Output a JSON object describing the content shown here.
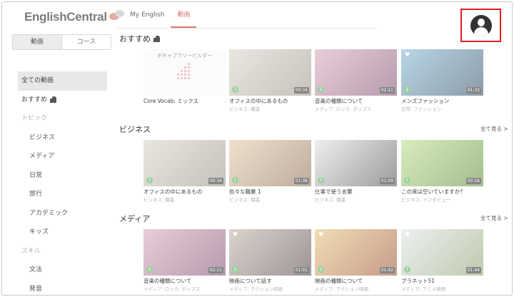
{
  "app": {
    "logo": "EnglishCentral"
  },
  "topnav": {
    "tabs": [
      {
        "label": "My English"
      },
      {
        "label": "動画"
      }
    ]
  },
  "sidebar": {
    "segment": [
      "動画",
      "コース"
    ],
    "items": [
      {
        "label": "全ての動画",
        "kind": "item",
        "active": true
      },
      {
        "label": "おすすめ",
        "kind": "item"
      },
      {
        "label": "トピック",
        "kind": "heading"
      },
      {
        "label": "ビジネス",
        "kind": "sub"
      },
      {
        "label": "メディア",
        "kind": "sub"
      },
      {
        "label": "日常",
        "kind": "sub"
      },
      {
        "label": "旅行",
        "kind": "sub"
      },
      {
        "label": "アカデミック",
        "kind": "sub"
      },
      {
        "label": "キッズ",
        "kind": "sub"
      },
      {
        "label": "スキル",
        "kind": "heading"
      },
      {
        "label": "文法",
        "kind": "sub"
      },
      {
        "label": "発音",
        "kind": "sub"
      }
    ]
  },
  "sections": [
    {
      "title": "おすすめ",
      "see_all": "",
      "cards": [
        {
          "title": "Core Vocab: ミックス",
          "category": "",
          "duration": "",
          "vocab_label": "ボキャブラリービルダー",
          "colors": [
            "#f5f5f5",
            "#eeeeee"
          ],
          "heart": false,
          "level": ""
        },
        {
          "title": "オフィスの中にあるもの",
          "category": "ビジネス: 職業",
          "duration": "00:34",
          "colors": [
            "#d9d2c8",
            "#9a8f84"
          ],
          "heart": false,
          "level": "1"
        },
        {
          "title": "音楽の種類について",
          "category": "メディア: ロック, ポップス",
          "duration": "02:11",
          "colors": [
            "#d8a4b9",
            "#7a4b6b"
          ],
          "heart": false,
          "level": "1"
        },
        {
          "title": "メンズファッション",
          "category": "日常: ファッション",
          "duration": "01:33",
          "colors": [
            "#7fb4d3",
            "#2e4a60"
          ],
          "heart": true,
          "level": "1"
        }
      ]
    },
    {
      "title": "ビジネス",
      "see_all": "全て見る >",
      "cards": [
        {
          "title": "オフィスの中にあるもの",
          "category": "ビジネス: 職業",
          "duration": "00:34",
          "colors": [
            "#d9d2c8",
            "#9a8f84"
          ],
          "heart": false,
          "level": "1"
        },
        {
          "title": "色々な職業 1",
          "category": "ビジネス: 職業",
          "duration": "01:38",
          "colors": [
            "#e4c8a7",
            "#8a6b4e"
          ],
          "heart": false,
          "level": "1"
        },
        {
          "title": "仕事で使う言葉",
          "category": "ビジネス: 職業",
          "duration": "01:09",
          "colors": [
            "#e2e2e2",
            "#4d4d4d"
          ],
          "heart": false,
          "level": "1"
        },
        {
          "title": "この席は空いていますか?",
          "category": "ビジネス: インタビュー",
          "duration": "00:16",
          "colors": [
            "#b9dd8a",
            "#5a8a34"
          ],
          "heart": false,
          "level": "1"
        }
      ]
    },
    {
      "title": "メディア",
      "see_all": "全て見る >",
      "cards": [
        {
          "title": "音楽の種類について",
          "category": "メディア: ロック, ポップス",
          "duration": "02:11",
          "colors": [
            "#d8a4b9",
            "#7a4b6b"
          ],
          "heart": false,
          "level": "1"
        },
        {
          "title": "映画について話す",
          "category": "メディア: アクション映画",
          "duration": "01:01",
          "colors": [
            "#bfb0a6",
            "#4e4040"
          ],
          "heart": true,
          "level": "1"
        },
        {
          "title": "映画の種類について",
          "category": "メディア: アクション映画",
          "duration": "01:42",
          "colors": [
            "#e6c37a",
            "#9b4b2b"
          ],
          "heart": true,
          "level": "1"
        },
        {
          "title": "プラネット51",
          "category": "メディア: アニメ映画",
          "duration": "01:44",
          "colors": [
            "#dfe3e6",
            "#8aa06a"
          ],
          "heart": true,
          "level": "1"
        }
      ]
    }
  ]
}
